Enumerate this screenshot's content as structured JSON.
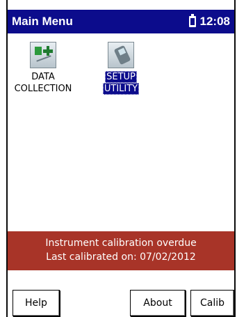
{
  "header": {
    "title": "Main Menu",
    "time": "12:08",
    "battery_icon": "battery-icon"
  },
  "apps": [
    {
      "line1": "DATA",
      "line2": "COLLECTION",
      "icon": "data-collection-icon"
    },
    {
      "line1": "SETUP",
      "line2": "UTILITY",
      "icon": "setup-utility-icon",
      "selected": true
    }
  ],
  "alert": {
    "line1": "Instrument calibration overdue",
    "line2": "Last calibrated on: 07/02/2012"
  },
  "buttons": {
    "help": "Help",
    "about": "About",
    "calib": "Calib"
  },
  "colors": {
    "titlebar": "#0c0c8c",
    "alert_bg": "#a83428",
    "selection": "#0c0c8c"
  }
}
